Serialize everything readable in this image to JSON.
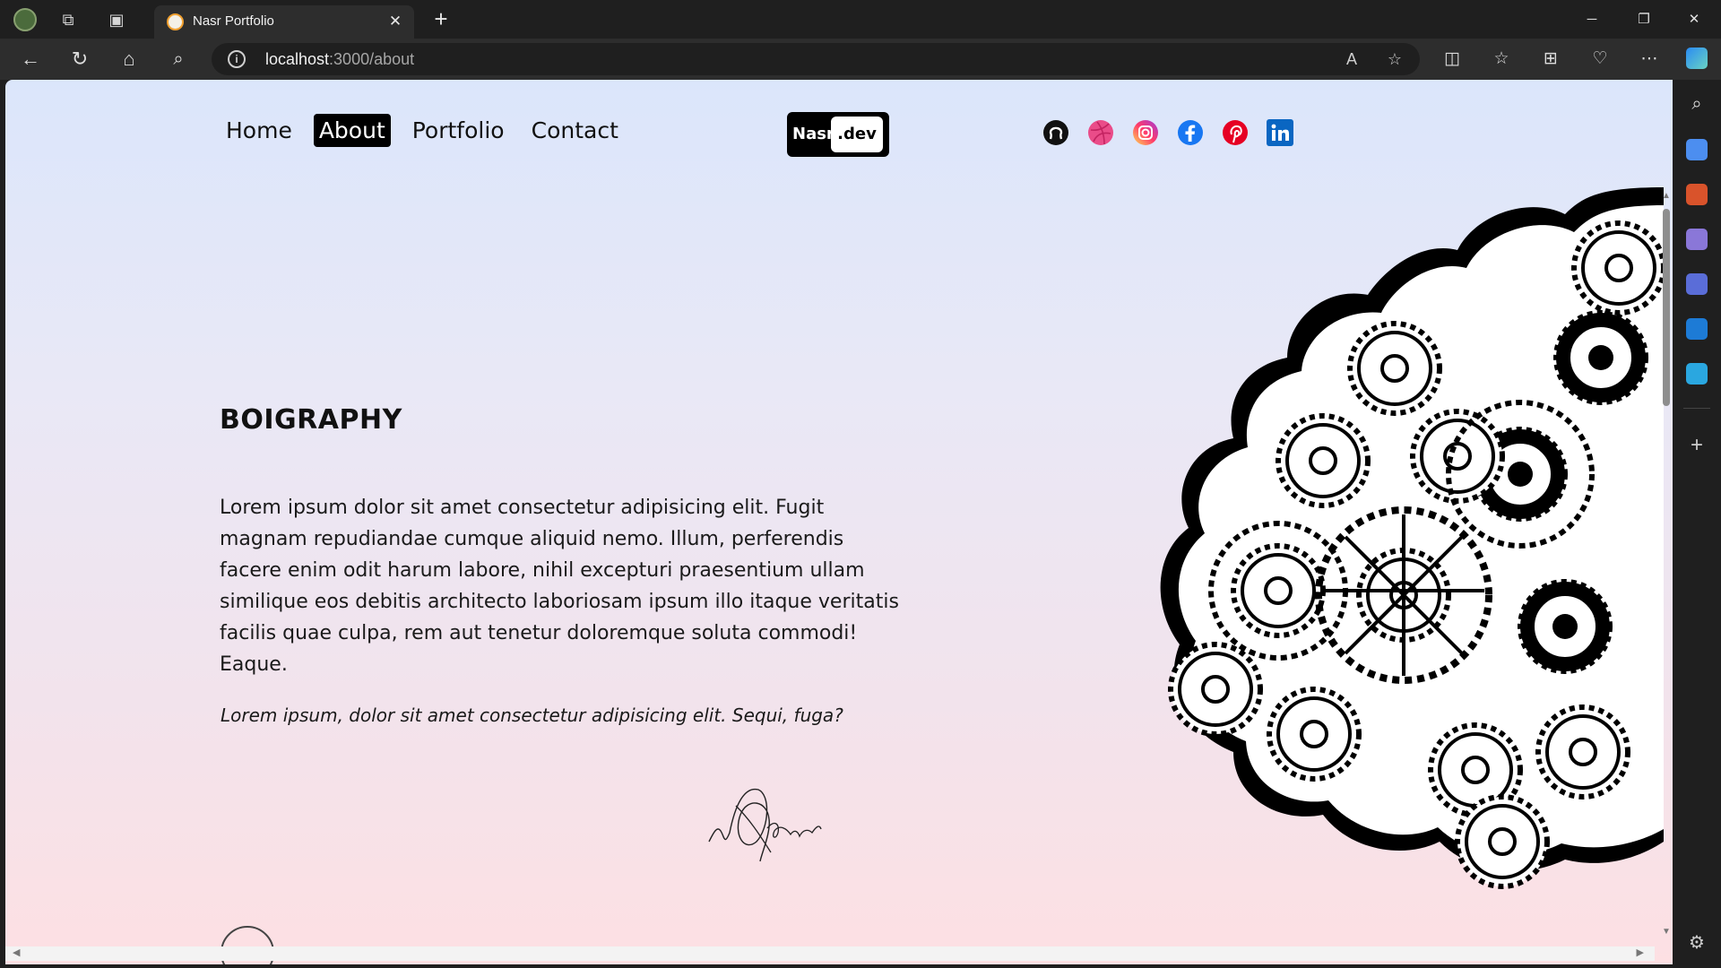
{
  "browser": {
    "tab_title": "Nasr Portfolio",
    "url_host": "localhost",
    "url_rest": ":3000/about",
    "new_tab_label": "+",
    "close_tab_label": "✕"
  },
  "nav": {
    "items": [
      {
        "label": "Home"
      },
      {
        "label": "About"
      },
      {
        "label": "Portfolio"
      },
      {
        "label": "Contact"
      }
    ],
    "active": "About"
  },
  "logo": {
    "part1": "Nasr",
    "part2": ".dev"
  },
  "social": [
    "github-icon",
    "dribbble-icon",
    "instagram-icon",
    "facebook-icon",
    "pinterest-icon",
    "linkedin-icon"
  ],
  "content": {
    "heading": "BOIGRAPHY",
    "paragraph": "Lorem ipsum dolor sit amet consectetur adipisicing elit. Fugit magnam repudiandae cumque aliquid nemo. Illum, perferendis facere enim odit harum labore, nihil excepturi praesentium ullam similique eos debitis architecto laboriosam ipsum illo itaque veritatis facilis quae culpa, rem aut tenetur doloremque soluta commodi! Eaque.",
    "quote": "Lorem ipsum, dolor sit amet consectetur adipisicing elit. Sequi, fuga?"
  },
  "colors": {
    "background_top": "#dbe6fb",
    "background_bottom": "#fde0e3",
    "nav_active_bg": "#000000",
    "dribbble": "#ea4c89",
    "facebook": "#1877f2",
    "pinterest": "#e60023",
    "linkedin": "#0a66c2"
  }
}
